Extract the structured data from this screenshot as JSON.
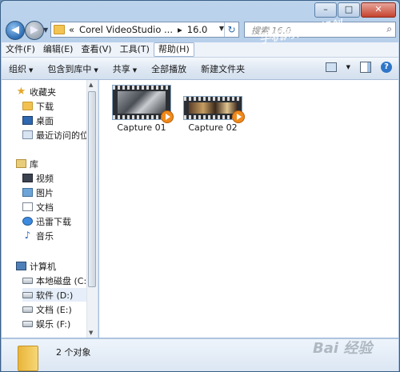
{
  "window": {
    "controls": [
      "–",
      "□",
      "✕"
    ]
  },
  "address": {
    "prefix": "«",
    "segments": [
      "Corel VideoStudio ...",
      "▸",
      "16.0"
    ],
    "search_placeholder": "搜索 16.0"
  },
  "menu": [
    "文件(F)",
    "编辑(E)",
    "查看(V)",
    "工具(T)",
    "帮助(H)"
  ],
  "toolbar": [
    "组织",
    "包含到库中",
    "共享",
    "全部播放",
    "新建文件夹"
  ],
  "nav": {
    "favorites": {
      "label": "收藏夹",
      "items": [
        "下载",
        "桌面",
        "最近访问的位置"
      ]
    },
    "libraries": {
      "label": "库",
      "items": [
        "视频",
        "图片",
        "文档",
        "迅雷下载",
        "音乐"
      ]
    },
    "computer": {
      "label": "计算机",
      "items": [
        "本地磁盘 (C:)",
        "软件 (D:)",
        "文档 (E:)",
        "娱乐 (F:)"
      ]
    }
  },
  "files": [
    {
      "name": "Capture 01",
      "type": "video"
    },
    {
      "name": "Capture 02",
      "type": "video"
    }
  ],
  "status": {
    "count": "2 个对象"
  },
  "watermark": {
    "top": "手机网台研胡创",
    "bottom": "Bai 经验"
  }
}
